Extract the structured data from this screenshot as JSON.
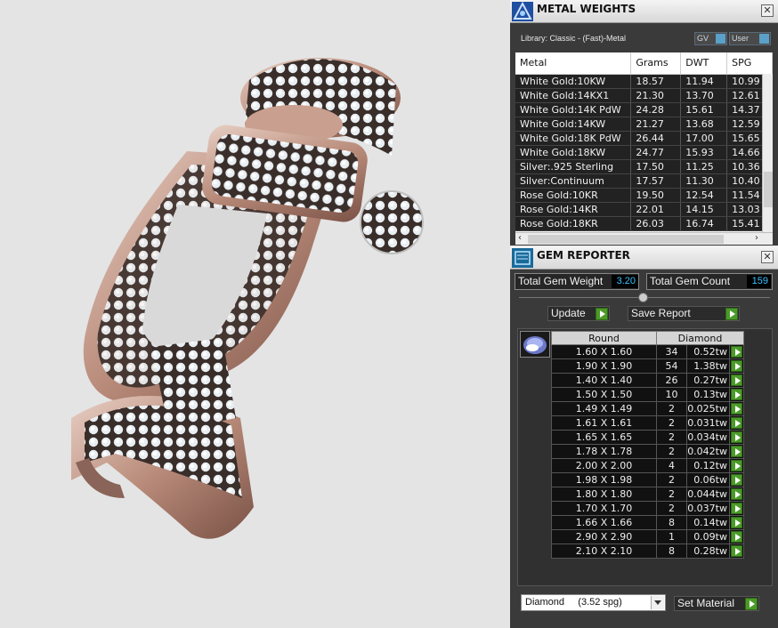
{
  "metal_weights": {
    "title": "METAL WEIGHTS",
    "library_label": "Library: Classic - (Fast)-Metal",
    "toggle_gv": "GV",
    "toggle_user": "User",
    "columns": [
      "Metal",
      "Grams",
      "DWT",
      "SPG"
    ],
    "rows": [
      [
        "White Gold:10KW",
        "18.57",
        "11.94",
        "10.99"
      ],
      [
        "White Gold:14KX1",
        "21.30",
        "13.70",
        "12.61"
      ],
      [
        "White Gold:14K PdW",
        "24.28",
        "15.61",
        "14.37"
      ],
      [
        "White Gold:14KW",
        "21.27",
        "13.68",
        "12.59"
      ],
      [
        "White Gold:18K PdW",
        "26.44",
        "17.00",
        "15.65"
      ],
      [
        "White Gold:18KW",
        "24.77",
        "15.93",
        "14.66"
      ],
      [
        "Silver:.925 Sterling",
        "17.50",
        "11.25",
        "10.36"
      ],
      [
        "Silver:Continuum",
        "17.57",
        "11.30",
        "10.40"
      ],
      [
        "Rose Gold:10KR",
        "19.50",
        "12.54",
        "11.54"
      ],
      [
        "Rose Gold:14KR",
        "22.01",
        "14.15",
        "13.03"
      ],
      [
        "Rose Gold:18KR",
        "26.03",
        "16.74",
        "15.41"
      ]
    ]
  },
  "gem_reporter": {
    "title": "GEM REPORTER",
    "total_weight_label": "Total Gem Weight",
    "total_weight_value": "3.20",
    "total_count_label": "Total Gem Count",
    "total_count_value": "159",
    "update_label": "Update",
    "save_report_label": "Save Report",
    "table_headers": [
      "Round",
      "Diamond"
    ],
    "rows": [
      [
        "1.60 X 1.60",
        "34",
        "0.52tw"
      ],
      [
        "1.90 X 1.90",
        "54",
        "1.38tw"
      ],
      [
        "1.40 X 1.40",
        "26",
        "0.27tw"
      ],
      [
        "1.50 X 1.50",
        "10",
        "0.13tw"
      ],
      [
        "1.49 X 1.49",
        "2",
        "0.025tw"
      ],
      [
        "1.61 X 1.61",
        "2",
        "0.031tw"
      ],
      [
        "1.65 X 1.65",
        "2",
        "0.034tw"
      ],
      [
        "1.78 X 1.78",
        "2",
        "0.042tw"
      ],
      [
        "2.00 X 2.00",
        "4",
        "0.12tw"
      ],
      [
        "1.98 X 1.98",
        "2",
        "0.06tw"
      ],
      [
        "1.80 X 1.80",
        "2",
        "0.044tw"
      ],
      [
        "1.70 X 1.70",
        "2",
        "0.037tw"
      ],
      [
        "1.66 X 1.66",
        "8",
        "0.14tw"
      ],
      [
        "2.90 X 2.90",
        "1",
        "0.09tw"
      ],
      [
        "2.10 X 2.10",
        "8",
        "0.28tw"
      ]
    ],
    "material_select": "Diamond     (3.52 spg)",
    "set_material_label": "Set Material"
  },
  "icons": {
    "metal_panel": "metal-weights-icon",
    "gem_panel": "gem-reporter-icon",
    "gem_thumb": "round-diamond-icon"
  },
  "colors": {
    "panel_bg": "#3a3a3a",
    "accent_green": "#4c9a2a",
    "value_blue": "#3cc0ff",
    "metal_rose": "#c9a08f"
  }
}
